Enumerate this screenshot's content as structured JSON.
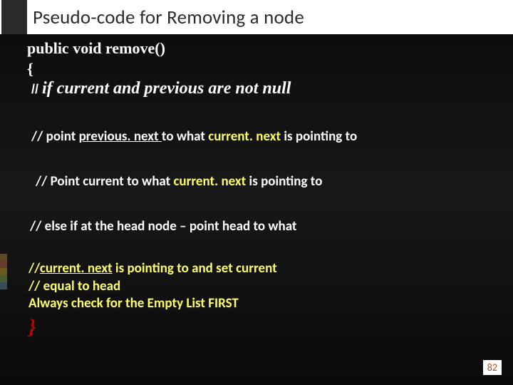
{
  "title": "Pseudo-code for Removing a node",
  "signature": "public void  remove()",
  "open_brace": "{",
  "line1_prefix": "// ",
  "line1_text": "if current and previous are not null",
  "line2_a": "// point ",
  "line2_b": "previous. next ",
  "line2_c": " to  what  ",
  "line2_d": "current. next",
  "line2_e": "  is  pointing  to",
  "line3_a": "// Point  current   to  what  ",
  "line3_b": "current. next",
  "line3_c": "  is  pointing  to",
  "line4": "// else if at the head node – point head to what",
  "block5_a1": "//",
  "block5_a2": "current. next",
  "block5_a3": "  is pointing to and set  ",
  "block5_a4": "current",
  "block5_b": "// equal to head",
  "block5_c": "Always check for the  Empty List  FIRST",
  "close_brace": "}",
  "page_number": "82"
}
